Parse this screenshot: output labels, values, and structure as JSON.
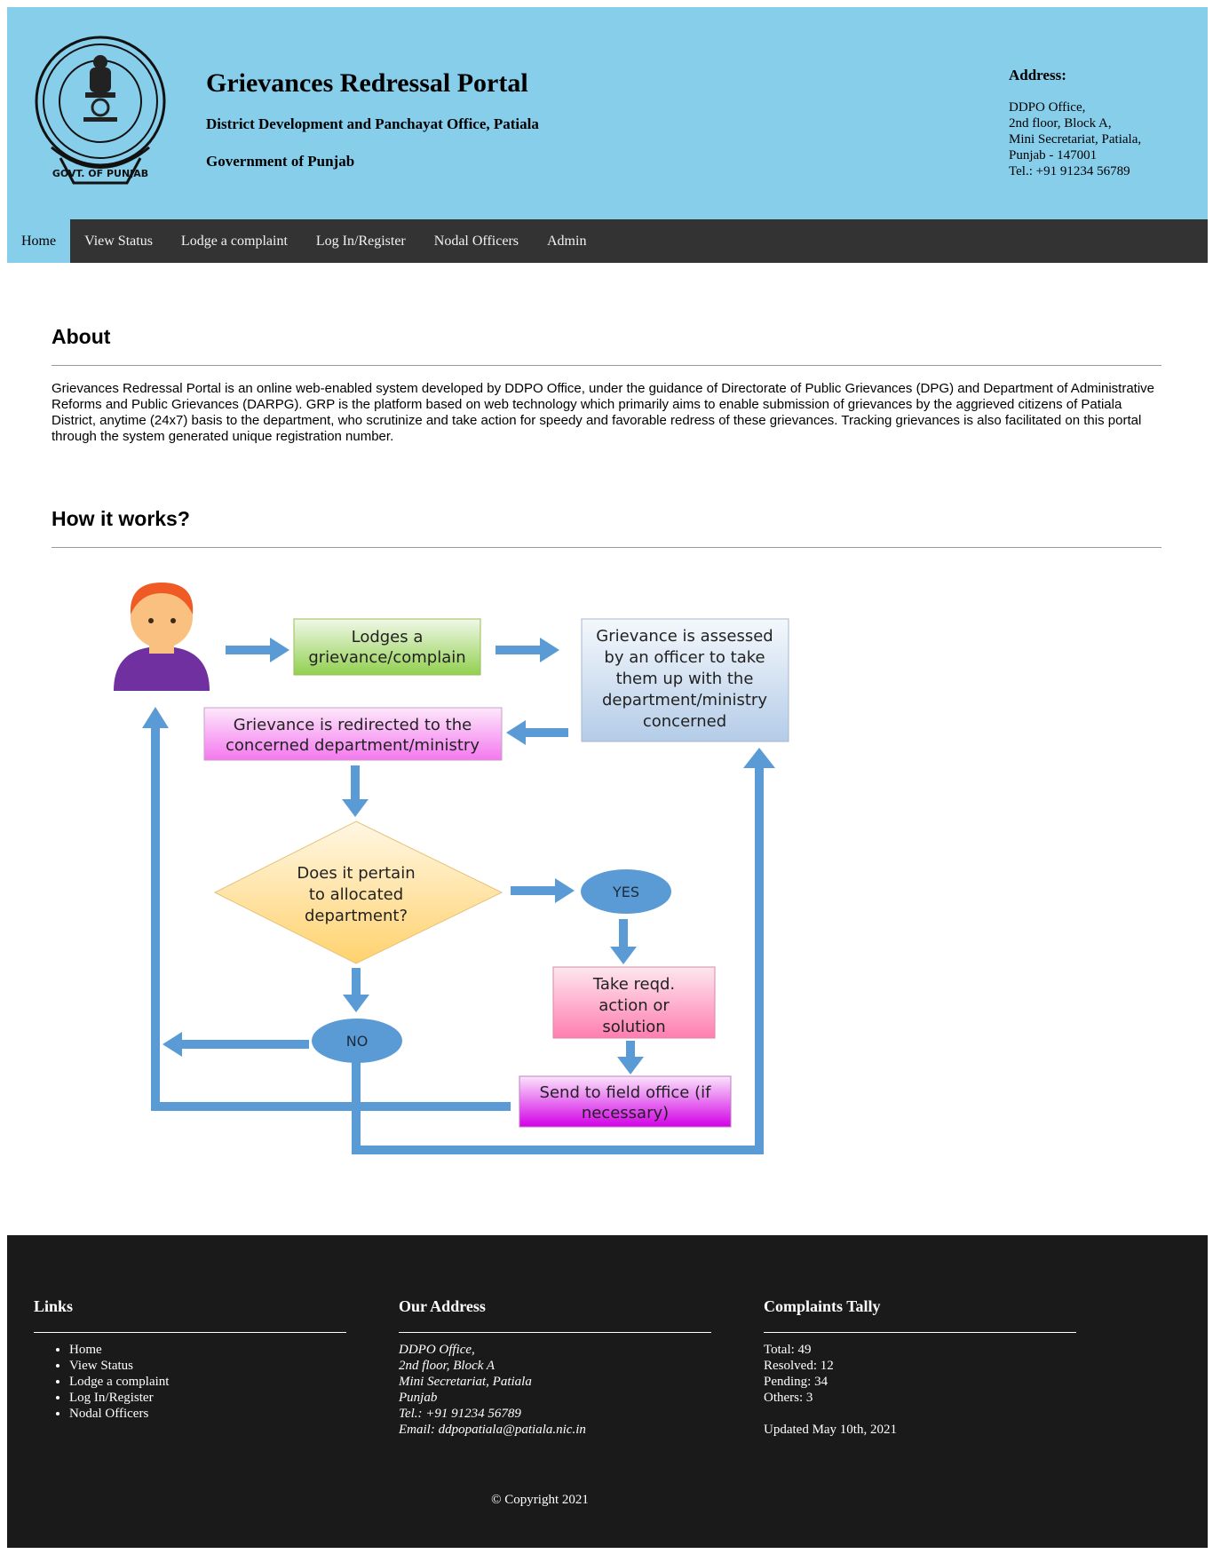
{
  "header": {
    "title": "Grievances Redressal Portal",
    "subtitle": "District Development and Panchayat Office, Patiala",
    "government": "Government of Punjab",
    "emblem_text": "GOVT. OF PUNJAB",
    "address_title": "Address:",
    "address_lines": [
      "DDPO Office,",
      "2nd floor, Block A,",
      "Mini Secretariat, Patiala,",
      "Punjab - 147001",
      "Tel.: +91 91234 56789"
    ]
  },
  "nav": [
    "Home",
    "View Status",
    "Lodge a complaint",
    "Log In/Register",
    "Nodal Officers",
    "Admin"
  ],
  "about": {
    "title": "About",
    "text": "Grievances Redressal Portal is an online web-enabled system developed by DDPO Office, under the guidance of Directorate of Public Grievances (DPG) and Department of Administrative Reforms and Public Grievances (DARPG). GRP is the platform based on web technology which primarily aims to enable submission of grievances by the aggrieved citizens of Patiala District, anytime (24x7) basis to the department, who scrutinize and take action for speedy and favorable redress of these grievances. Tracking grievances is also facilitated on this portal through the system generated unique registration number."
  },
  "how": {
    "title": "How it works?",
    "steps": {
      "lodge": [
        "Lodges a",
        "grievance/complain"
      ],
      "assess": [
        "Grievance is assessed",
        "by an officer to take",
        "them up with the",
        "department/ministry",
        "concerned"
      ],
      "redirect": [
        "Grievance is redirected to the",
        "concerned department/ministry"
      ],
      "decision": [
        "Does it pertain",
        "to allocated",
        "department?"
      ],
      "yes": "YES",
      "no": "NO",
      "action": [
        "Take reqd.",
        "action or",
        "solution"
      ],
      "field": [
        "Send to field office (if",
        "necessary)"
      ]
    }
  },
  "footer": {
    "links_title": "Links",
    "links": [
      "Home",
      "View Status",
      "Lodge a complaint",
      "Log In/Register",
      "Nodal Officers"
    ],
    "address_title": "Our Address",
    "address_lines": [
      "DDPO Office,",
      "2nd floor, Block A",
      "Mini Secretariat, Patiala",
      "Punjab",
      "Tel.: +91 91234 56789",
      "Email: ddpopatiala@patiala.nic.in"
    ],
    "tally_title": "Complaints Tally",
    "tally_lines": [
      "Total: 49",
      "Resolved: 12",
      "Pending: 34",
      "Others: 3"
    ],
    "updated": "Updated May 10th, 2021",
    "copyright": "© Copyright 2021"
  },
  "colors": {
    "header_bg": "#87ceeb",
    "nav_bg": "#333333",
    "footer_bg": "#1a1a1a",
    "arrow": "#5b9bd5"
  }
}
